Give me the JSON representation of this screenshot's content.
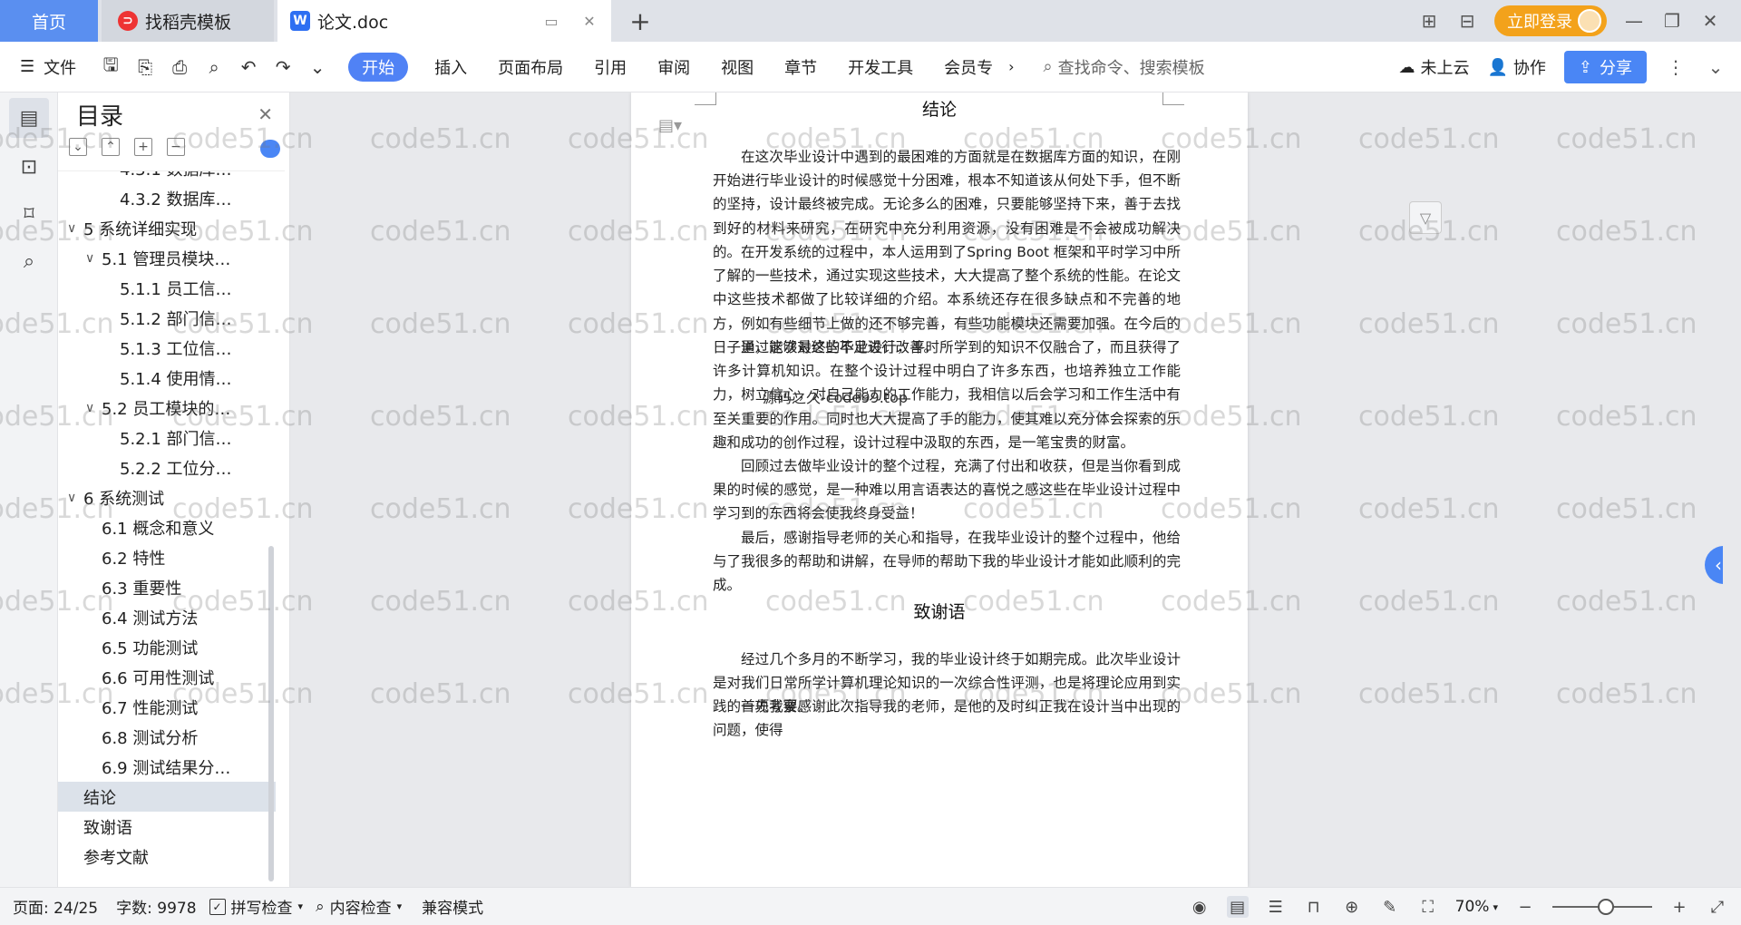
{
  "tabs": {
    "home": "首页",
    "template": "找稻壳模板",
    "document": "论文.doc",
    "add": "+"
  },
  "titlebar": {
    "login": "立即登录"
  },
  "ribbon": {
    "file": "文件",
    "tabs": [
      "开始",
      "插入",
      "页面布局",
      "引用",
      "审阅",
      "视图",
      "章节",
      "开发工具",
      "会员专"
    ],
    "search_placeholder": "查找命令、搜索模板",
    "cloud": "未上云",
    "collab": "协作",
    "share": "分享"
  },
  "toc": {
    "title": "目录",
    "items": [
      {
        "label": "4.3.1 数据库…",
        "level": 3
      },
      {
        "label": "4.3.2 数据库…",
        "level": 3
      },
      {
        "label": "5 系统详细实现",
        "level": 1,
        "caret": "∨"
      },
      {
        "label": "5.1 管理员模块…",
        "level": 2,
        "caret": "∨"
      },
      {
        "label": "5.1.1 员工信…",
        "level": 3
      },
      {
        "label": "5.1.2 部门信…",
        "level": 3
      },
      {
        "label": "5.1.3 工位信…",
        "level": 3
      },
      {
        "label": "5.1.4 使用情…",
        "level": 3
      },
      {
        "label": "5.2 员工模块的…",
        "level": 2,
        "caret": "∨"
      },
      {
        "label": "5.2.1 部门信…",
        "level": 3
      },
      {
        "label": "5.2.2 工位分…",
        "level": 3
      },
      {
        "label": "6 系统测试",
        "level": 1,
        "caret": "∨"
      },
      {
        "label": "6.1 概念和意义",
        "level": 2
      },
      {
        "label": "6.2 特性",
        "level": 2
      },
      {
        "label": "6.3 重要性",
        "level": 2
      },
      {
        "label": "6.4 测试方法",
        "level": 2
      },
      {
        "label": "6.5  功能测试",
        "level": 2
      },
      {
        "label": "6.6 可用性测试",
        "level": 2
      },
      {
        "label": "6.7 性能测试",
        "level": 2
      },
      {
        "label": "6.8 测试分析",
        "level": 2
      },
      {
        "label": "6.9 测试结果分…",
        "level": 2
      },
      {
        "label": "结论",
        "level": 1,
        "active": true
      },
      {
        "label": "致谢语",
        "level": 1
      },
      {
        "label": "参考文献",
        "level": 1
      }
    ]
  },
  "document": {
    "heading1": "结论",
    "paragraphs": [
      "在这次毕业设计中遇到的最困难的方面就是在数据库方面的知识，在刚开始进行毕业设计的时候感觉十分困难，根本不知道该从何处下手，但不断的坚持，设计最终被完成。无论多么的困难，只要能够坚持下来，善于去找到好的材料来研究，在研究中充分利用资源，没有困难是不会被成功解决的。",
      "在开发系统的过程中，本人运用到了Spring Boot 框架和平时学习中所了解的一些技术，通过实现这些技术，大大提高了整个系统的性能。在论文中这些技术都做了比较详细的介绍。本系统还存在很多缺点和不完善的地方，例如有些细节上做的还不够完善，有些功能模块还需要加强。在今后的日子里，能够对这些不足进行改善。",
      "通过这次最终的毕业设计，平时所学到的知识不仅融合了，而且获得了许多计算机知识。在整个设计过程中明白了许多东西，也培养独立工作能力，树立信心，对自己能力的工作能力，我相信以后会学习和工作生活中有至关重要的作用。同时也大大提高了手的能力，使其难以充分体会探索的乐趣和成功的创作过程，设计过程中汲取的东西，是一笔宝贵的财富。",
      "回顾过去做毕业设计的整个过程，充满了付出和收获，但是当你看到成果的时候的感觉，是一种难以用言语表达的喜悦之感这些在毕业设计过程中学习到的东西将会使我终身受益！",
      "最后，感谢指导老师的关心和指导，在我毕业设计的整个过程中，他给与了我很多的帮助和讲解，在导师的帮助下我的毕业设计才能如此顺利的完成。"
    ],
    "overlay": "源码之久-code99.top",
    "heading2": "致谢语",
    "paragraphs2": [
      "经过几个多月的不断学习，我的毕业设计终于如期完成。此次毕业设计是对我们日常所学计算机理论知识的一次综合性评测，也是将理论应用到实践的一项考察。",
      "首先我要感谢此次指导我的老师，是他的及时纠正我在设计当中出现的问题，使得"
    ]
  },
  "watermark": "code51.cn",
  "statusbar": {
    "page": "页面: 24/25",
    "words": "字数: 9978",
    "spell": "拼写检查",
    "content": "内容检查",
    "compat": "兼容模式",
    "zoom": "70%",
    "zoom_value": 0.7
  },
  "colors": {
    "accent": "#5082f5",
    "login": "#f3a21b",
    "home_tab": "#5a8ff0"
  }
}
